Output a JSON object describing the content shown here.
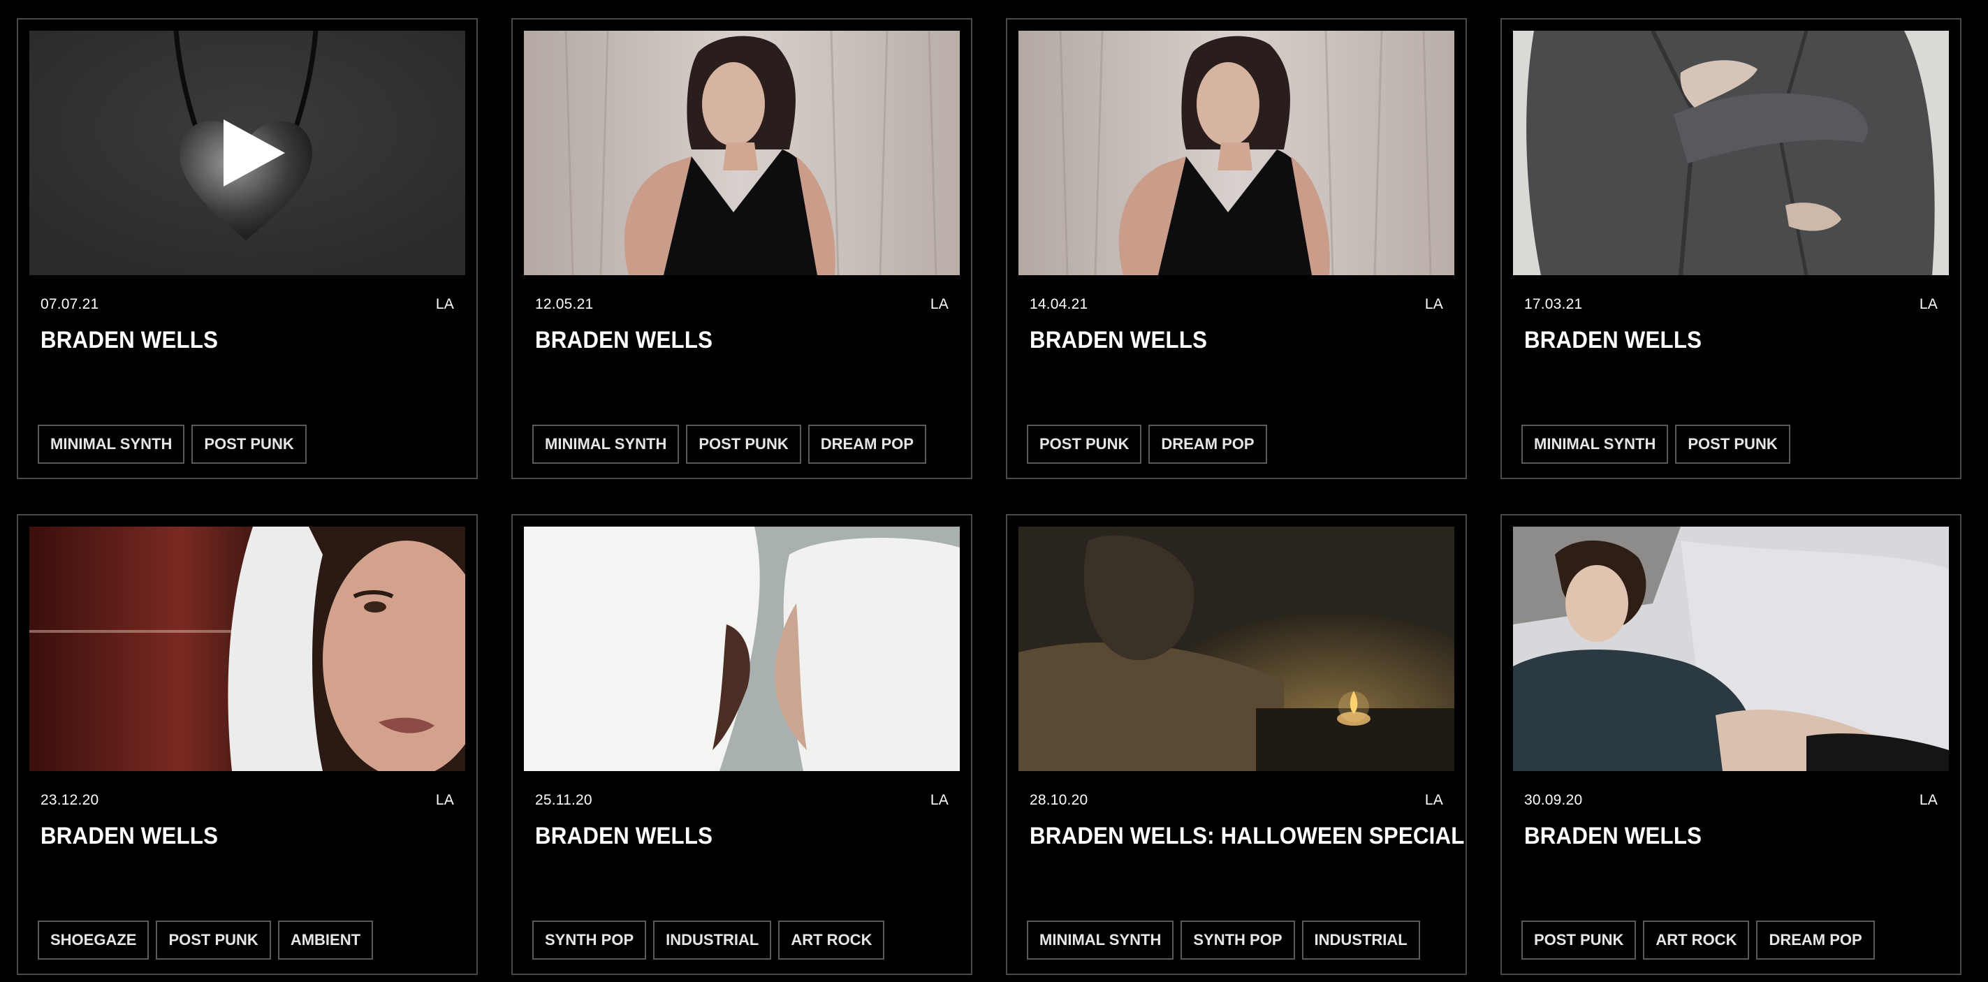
{
  "cards": [
    {
      "date": "07.07.21",
      "city": "LA",
      "title": "BRADEN WELLS",
      "tags": [
        "MINIMAL SYNTH",
        "POST PUNK"
      ],
      "thumbnail": "silver heart pendant necklace",
      "playing_overlay": true
    },
    {
      "date": "12.05.21",
      "city": "LA",
      "title": "BRADEN WELLS",
      "tags": [
        "MINIMAL SYNTH",
        "POST PUNK",
        "DREAM POP"
      ],
      "thumbnail": "woman in black vest against white curtain"
    },
    {
      "date": "14.04.21",
      "city": "LA",
      "title": "BRADEN WELLS",
      "tags": [
        "POST PUNK",
        "DREAM POP"
      ],
      "thumbnail": "woman in black vest against white curtain"
    },
    {
      "date": "17.03.21",
      "city": "LA",
      "title": "BRADEN WELLS",
      "tags": [
        "MINIMAL SYNTH",
        "POST PUNK"
      ],
      "thumbnail": "grey suit jacket with hands"
    },
    {
      "date": "23.12.20",
      "city": "LA",
      "title": "BRADEN WELLS",
      "tags": [
        "SHOEGAZE",
        "POST PUNK",
        "AMBIENT"
      ],
      "thumbnail": "face in white hood, red curtain"
    },
    {
      "date": "25.11.20",
      "city": "LA",
      "title": "BRADEN WELLS",
      "tags": [
        "SYNTH POP",
        "INDUSTRIAL",
        "ART ROCK"
      ],
      "thumbnail": "two hooded figures kissing"
    },
    {
      "date": "28.10.20",
      "city": "LA",
      "title": "BRADEN WELLS: HALLOWEEN SPECIAL",
      "tags": [
        "MINIMAL SYNTH",
        "SYNTH POP",
        "INDUSTRIAL"
      ],
      "thumbnail": "dark painting with candle"
    },
    {
      "date": "30.09.20",
      "city": "LA",
      "title": "BRADEN WELLS",
      "tags": [
        "POST PUNK",
        "ART ROCK",
        "DREAM POP"
      ],
      "thumbnail": "woman lying on white bed"
    }
  ],
  "colors": {
    "background": "#000000",
    "card_border": "#4a4a4a",
    "tag_border": "#5a5a5a",
    "text": "#ffffff"
  }
}
